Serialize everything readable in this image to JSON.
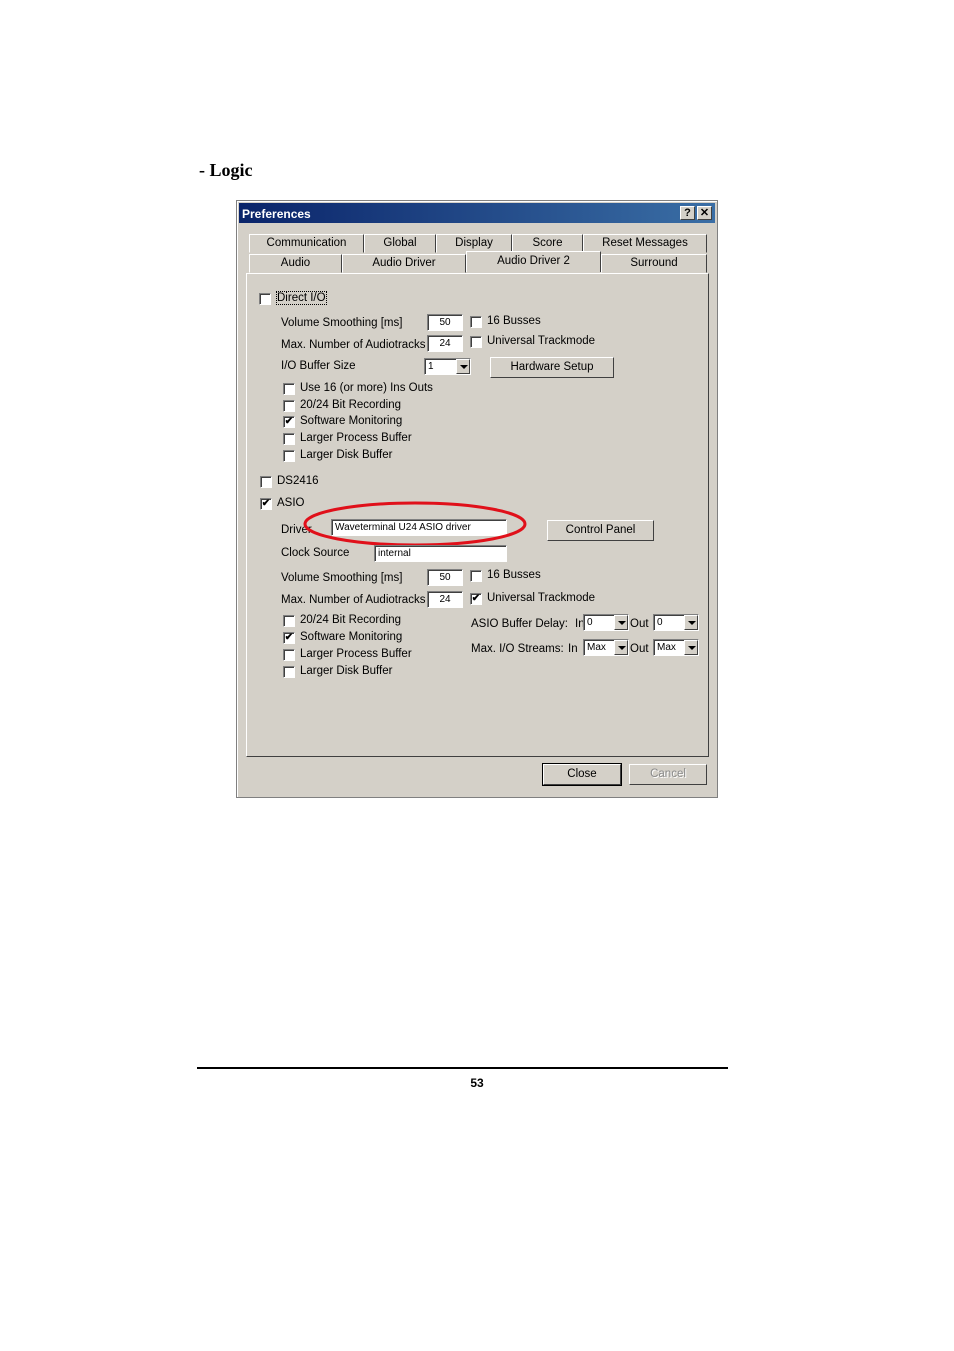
{
  "heading": "- Logic",
  "dialog": {
    "title": "Preferences",
    "help_glyph": "?",
    "close_glyph": "✕",
    "tabs_row1": [
      "Communication",
      "Global",
      "Display",
      "Score",
      "Reset Messages"
    ],
    "tabs_row2": [
      "Audio",
      "Audio Driver",
      "Audio Driver 2",
      "Surround"
    ],
    "active_tab": "Audio Driver 2",
    "direct_io": {
      "label": "Direct I/O",
      "checked": false,
      "volume_smoothing_label": "Volume Smoothing [ms]",
      "volume_smoothing_value": "50",
      "max_audiotracks_label": "Max. Number of Audiotracks",
      "max_audiotracks_value": "24",
      "busses16_label": "16 Busses",
      "busses16_checked": false,
      "universal_trackmode_label": "Universal Trackmode",
      "universal_trackmode_checked": false,
      "io_buffer_label": "I/O Buffer Size",
      "io_buffer_value": "1",
      "hardware_setup_button": "Hardware Setup",
      "options": [
        {
          "label": "Use 16 (or more) Ins  Outs",
          "checked": false
        },
        {
          "label": "20/24 Bit Recording",
          "checked": false
        },
        {
          "label": "Software Monitoring",
          "checked": true
        },
        {
          "label": "Larger Process Buffer",
          "checked": false
        },
        {
          "label": "Larger Disk Buffer",
          "checked": false
        }
      ]
    },
    "ds2416": {
      "label": "DS2416",
      "checked": false
    },
    "asio": {
      "label": "ASIO",
      "checked": true,
      "driver_label": "Driver",
      "driver_value": "Waveterminal U24 ASIO driver",
      "highlight_color": "#e0101a",
      "control_panel_button": "Control Panel",
      "clock_source_label": "Clock Source",
      "clock_source_value": "internal",
      "volume_smoothing_label": "Volume Smoothing [ms]",
      "volume_smoothing_value": "50",
      "max_audiotracks_label": "Max. Number of Audiotracks",
      "max_audiotracks_value": "24",
      "busses16_label": "16 Busses",
      "busses16_checked": false,
      "universal_trackmode_label": "Universal Trackmode",
      "universal_trackmode_checked": true,
      "options": [
        {
          "label": "20/24 Bit Recording",
          "checked": false
        },
        {
          "label": "Software Monitoring",
          "checked": true
        },
        {
          "label": "Larger Process Buffer",
          "checked": false
        },
        {
          "label": "Larger Disk Buffer",
          "checked": false
        }
      ],
      "buffer_delay_label": "ASIO Buffer Delay:",
      "in_short": "In",
      "out_label": "Out",
      "buffer_delay_in": "0",
      "buffer_delay_out": "0",
      "max_io_streams_label": "Max. I/O Streams:",
      "in_label": "In",
      "streams_in": "Max",
      "streams_out": "Max"
    },
    "close_button": "Close",
    "cancel_button": "Cancel"
  },
  "page_number": "53"
}
